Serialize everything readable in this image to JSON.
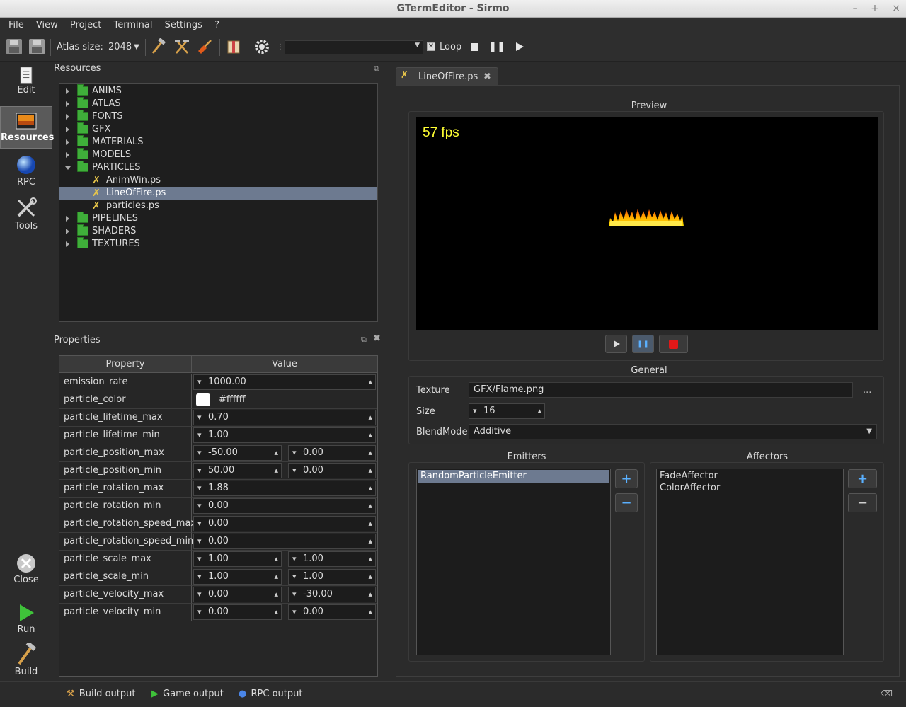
{
  "window": {
    "title": "GTermEditor - Sirmo",
    "controls": [
      "–",
      "+",
      "×"
    ]
  },
  "menu": [
    "File",
    "View",
    "Project",
    "Terminal",
    "Settings",
    "?"
  ],
  "toolbar": {
    "atlas_label": "Atlas size:",
    "atlas_value": "2048",
    "loop_label": "Loop",
    "loop_checked": true
  },
  "sidebar": {
    "edit": "Edit",
    "resources": "Resources",
    "rpc": "RPC",
    "tools": "Tools",
    "close": "Close",
    "run": "Run",
    "build": "Build"
  },
  "resources": {
    "title": "Resources",
    "tree": [
      {
        "label": "ANIMS",
        "type": "folder",
        "expanded": false
      },
      {
        "label": "ATLAS",
        "type": "folder",
        "expanded": false
      },
      {
        "label": "FONTS",
        "type": "folder",
        "expanded": false
      },
      {
        "label": "GFX",
        "type": "folder",
        "expanded": false
      },
      {
        "label": "MATERIALS",
        "type": "folder",
        "expanded": false
      },
      {
        "label": "MODELS",
        "type": "folder",
        "expanded": false
      },
      {
        "label": "PARTICLES",
        "type": "folder",
        "expanded": true
      },
      {
        "label": "AnimWin.ps",
        "type": "file"
      },
      {
        "label": "LineOfFire.ps",
        "type": "file",
        "selected": true
      },
      {
        "label": "particles.ps",
        "type": "file"
      },
      {
        "label": "PIPELINES",
        "type": "folder",
        "expanded": false
      },
      {
        "label": "SHADERS",
        "type": "folder",
        "expanded": false
      },
      {
        "label": "TEXTURES",
        "type": "folder",
        "expanded": false
      }
    ]
  },
  "properties": {
    "title": "Properties",
    "col_property": "Property",
    "col_value": "Value",
    "rows": [
      {
        "name": "emission_rate",
        "v1": "1000.00"
      },
      {
        "name": "particle_color",
        "color": "#ffffff",
        "v1": "#ffffff"
      },
      {
        "name": "particle_lifetime_max",
        "v1": "0.70"
      },
      {
        "name": "particle_lifetime_min",
        "v1": "1.00"
      },
      {
        "name": "particle_position_max",
        "v1": "-50.00",
        "v2": "0.00"
      },
      {
        "name": "particle_position_min",
        "v1": "50.00",
        "v2": "0.00"
      },
      {
        "name": "particle_rotation_max",
        "v1": "1.88"
      },
      {
        "name": "particle_rotation_min",
        "v1": "0.00"
      },
      {
        "name": "particle_rotation_speed_max",
        "v1": "0.00"
      },
      {
        "name": "particle_rotation_speed_min",
        "v1": "0.00"
      },
      {
        "name": "particle_scale_max",
        "v1": "1.00",
        "v2": "1.00"
      },
      {
        "name": "particle_scale_min",
        "v1": "1.00",
        "v2": "1.00"
      },
      {
        "name": "particle_velocity_max",
        "v1": "0.00",
        "v2": "-30.00"
      },
      {
        "name": "particle_velocity_min",
        "v1": "0.00",
        "v2": "0.00"
      }
    ]
  },
  "editor": {
    "tab": "LineOfFire.ps",
    "preview_title": "Preview",
    "fps": "57 fps",
    "general_title": "General",
    "texture_label": "Texture",
    "texture_value": "GFX/Flame.png",
    "browse": "...",
    "size_label": "Size",
    "size_value": "16",
    "blend_label": "BlendMode",
    "blend_value": "Additive",
    "emitters_title": "Emitters",
    "emitters": [
      "RandomParticleEmitter"
    ],
    "affectors_title": "Affectors",
    "affectors": [
      "FadeAffector",
      "ColorAffector"
    ],
    "add": "+",
    "remove": "−"
  },
  "outputs": [
    "Build output",
    "Game output",
    "RPC output"
  ],
  "colors": {
    "accent_selection": "#6d7a90",
    "fps_text": "#ffff33",
    "folder": "#3fae3a"
  }
}
